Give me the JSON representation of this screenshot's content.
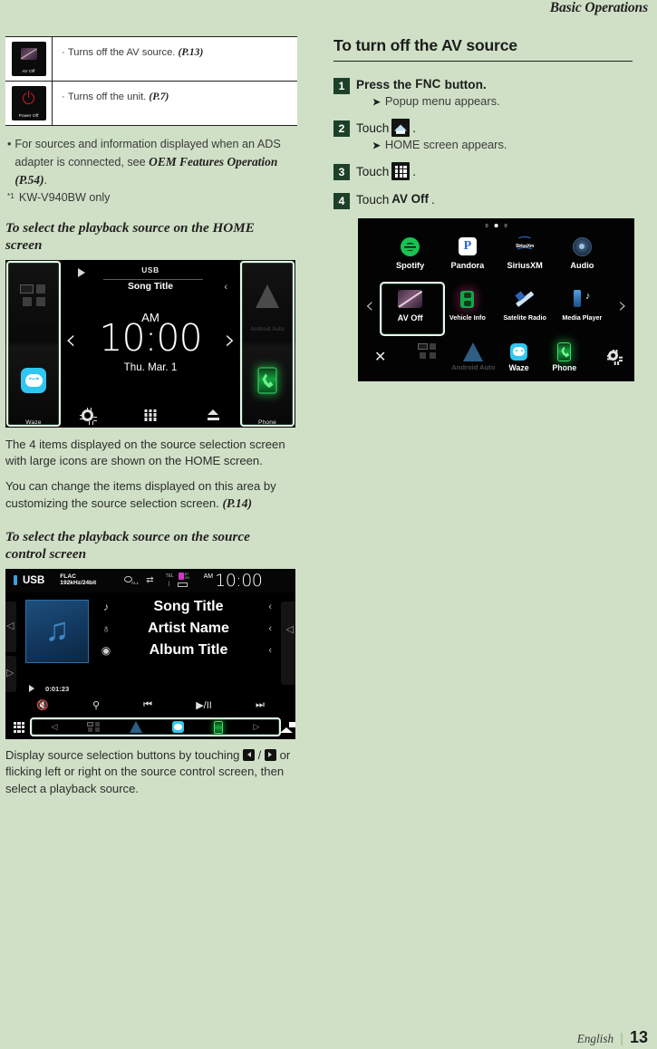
{
  "running_head": "Basic Operations",
  "colors": {
    "page_bg": "#cfe0c6",
    "step_badge": "#1d4029",
    "highlight_border": "#e9f3e6"
  },
  "left_column": {
    "table": {
      "rows": [
        {
          "icon_label": "AV Off",
          "icon_name": "av-off-icon",
          "text": "Turns off the AV source.",
          "ref": "(P.13)"
        },
        {
          "icon_label": "Power Off",
          "icon_name": "power-off-icon",
          "text": "Turns off the unit.",
          "ref": "(P.7)"
        }
      ]
    },
    "notes": [
      {
        "bullet": "•",
        "text_before": "For sources and information displayed when an ADS adapter is connected, see ",
        "emphasis": "OEM Features Operation (P.54)",
        "text_after": "."
      }
    ],
    "footnote": {
      "marker": "*1",
      "text": "KW-V940BW only"
    },
    "heading_home": "To select the playback source on the HOME screen",
    "home_screen": {
      "source_label": "USB",
      "song_title": "Song Title",
      "ampm": "AM",
      "time": "10:00",
      "date": "Thu. Mar.  1",
      "left_tiles": [
        {
          "label": "",
          "icon": "apps-icon"
        },
        {
          "label": "Waze",
          "icon": "waze-icon"
        }
      ],
      "right_tiles": [
        {
          "label": "Android Auto",
          "icon": "android-auto-icon"
        },
        {
          "label": "Phone",
          "icon": "phone-icon"
        }
      ],
      "bottom_icons": [
        "gear-icon",
        "apps-grid-icon",
        "eject-icon"
      ],
      "arrow_left": "‹",
      "arrow_right": "›",
      "chevron": "‹"
    },
    "para_1": "The 4 items displayed on the source selection screen with large icons are shown on the HOME screen.",
    "para_2_before": "You can change the items displayed on this area by customizing the source selection screen. ",
    "para_2_ref": "(P.14)",
    "heading_source": "To select the playback source on the source control screen",
    "source_screen": {
      "source_label": "USB",
      "codec_line1": "FLAC",
      "codec_line2": "192kHz/24bit",
      "repeat_icon": "repeat-all-icon",
      "shuffle_icon": "shuffle-icon",
      "tel_label": "TEL",
      "bt_label": "BT",
      "signal_label": "▄▄▄",
      "ampm": "AM",
      "time": "10:00",
      "rows": [
        {
          "icon": "note-icon",
          "glyph": "♪",
          "text": "Song Title",
          "chevron": "‹"
        },
        {
          "icon": "artist-icon",
          "glyph": "♁",
          "text": "Artist Name",
          "chevron": "‹"
        },
        {
          "icon": "disc-icon",
          "glyph": "◉",
          "text": "Album Title",
          "chevron": "‹"
        }
      ],
      "elapsed": "0:01:23",
      "controls": [
        "mute-icon",
        "search-icon",
        "previous-track-icon",
        "play-pause-icon",
        "next-track-icon"
      ],
      "control_glyphs": [
        "🔇",
        "⌕",
        "⏮",
        "▶/II",
        "⏭"
      ],
      "strip_arrow_left": "◁",
      "strip_arrow_right": "▷",
      "strip_icons": [
        "apps-icon",
        "android-auto-icon",
        "waze-icon",
        "phone-icon"
      ],
      "grid_icon": "apps-grid-icon",
      "home_icon": "home-icon"
    },
    "para_3_before": "Display source selection buttons by touching ",
    "para_3_mid": " / ",
    "para_3_after": " or flicking left or right on the source control screen, then select a playback source."
  },
  "right_column": {
    "heading": "To turn off the AV source",
    "steps": [
      {
        "num": "1",
        "prefix": "Press the",
        "kbd": "FNC",
        "suffix": "button.",
        "sub_arrow": "➤",
        "sub": "Popup menu appears."
      },
      {
        "num": "2",
        "prefix": "Touch",
        "icon": "home-icon",
        "suffix": ".",
        "sub_arrow": "➤",
        "sub": "HOME screen appears."
      },
      {
        "num": "3",
        "prefix": "Touch",
        "icon": "apps-grid-icon",
        "suffix": "."
      },
      {
        "num": "4",
        "prefix": "Touch",
        "kbd": "AV Off",
        "suffix": "."
      }
    ],
    "av_screen": {
      "page_dots": 3,
      "active_dot": 1,
      "row1": [
        {
          "label": "Spotify",
          "icon": "spotify-icon"
        },
        {
          "label": "Pandora",
          "icon": "pandora-icon"
        },
        {
          "label": "SiriusXM",
          "icon": "siriusxm-icon"
        },
        {
          "label": "Audio",
          "icon": "audio-icon"
        }
      ],
      "row2": [
        {
          "label": "AV Off",
          "icon": "av-off-icon",
          "selected": true
        },
        {
          "label": "Vehicle Info",
          "icon": "vehicle-info-icon"
        },
        {
          "label": "Satelite Radio",
          "icon": "satellite-radio-icon"
        },
        {
          "label": "Media Player",
          "icon": "media-player-icon"
        }
      ],
      "row3": [
        {
          "label": "",
          "icon": "apps-icon"
        },
        {
          "label": "Android Auto",
          "icon": "android-auto-icon",
          "dim": true
        },
        {
          "label": "Waze",
          "icon": "waze-icon"
        },
        {
          "label": "Phone",
          "icon": "phone-icon"
        }
      ],
      "close_icon": "close-icon",
      "settings_icon": "gear-icon",
      "arrow_left": "‹",
      "arrow_right": "›",
      "siriusxm_mark": "SiriusXm",
      "pandora_mark": "P"
    }
  },
  "footer": {
    "language": "English",
    "separator": "|",
    "page_number": "13"
  }
}
